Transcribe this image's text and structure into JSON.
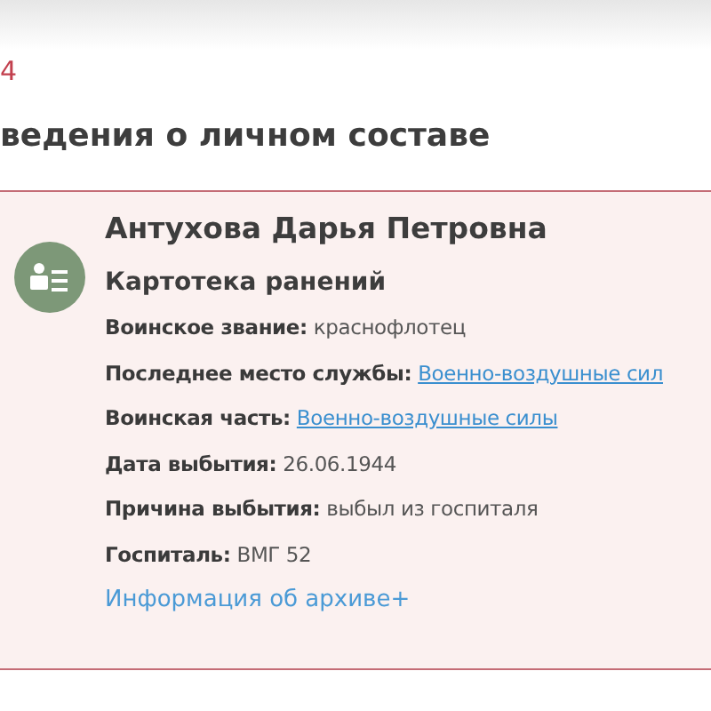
{
  "section_number": "4",
  "heading": "ведения о личном составе",
  "card": {
    "name": "Антухова Дарья Петровна",
    "source": "Картотека ранений",
    "fields": [
      {
        "kind": "text",
        "label": "Воинское звание:",
        "value": "краснофлотец"
      },
      {
        "kind": "link",
        "label": "Последнее место службы:",
        "value": "Военно-воздушные сил"
      },
      {
        "kind": "link",
        "label": "Воинская часть:",
        "value": "Военно-воздушные силы"
      },
      {
        "kind": "text",
        "label": "Дата выбытия:",
        "value": "26.06.1944"
      },
      {
        "kind": "text",
        "label": "Причина выбытия:",
        "value": "выбыл из госпиталя"
      },
      {
        "kind": "text",
        "label": "Госпиталь:",
        "value": "ВМГ 52"
      }
    ],
    "archive_link": "Информация об архиве+"
  }
}
